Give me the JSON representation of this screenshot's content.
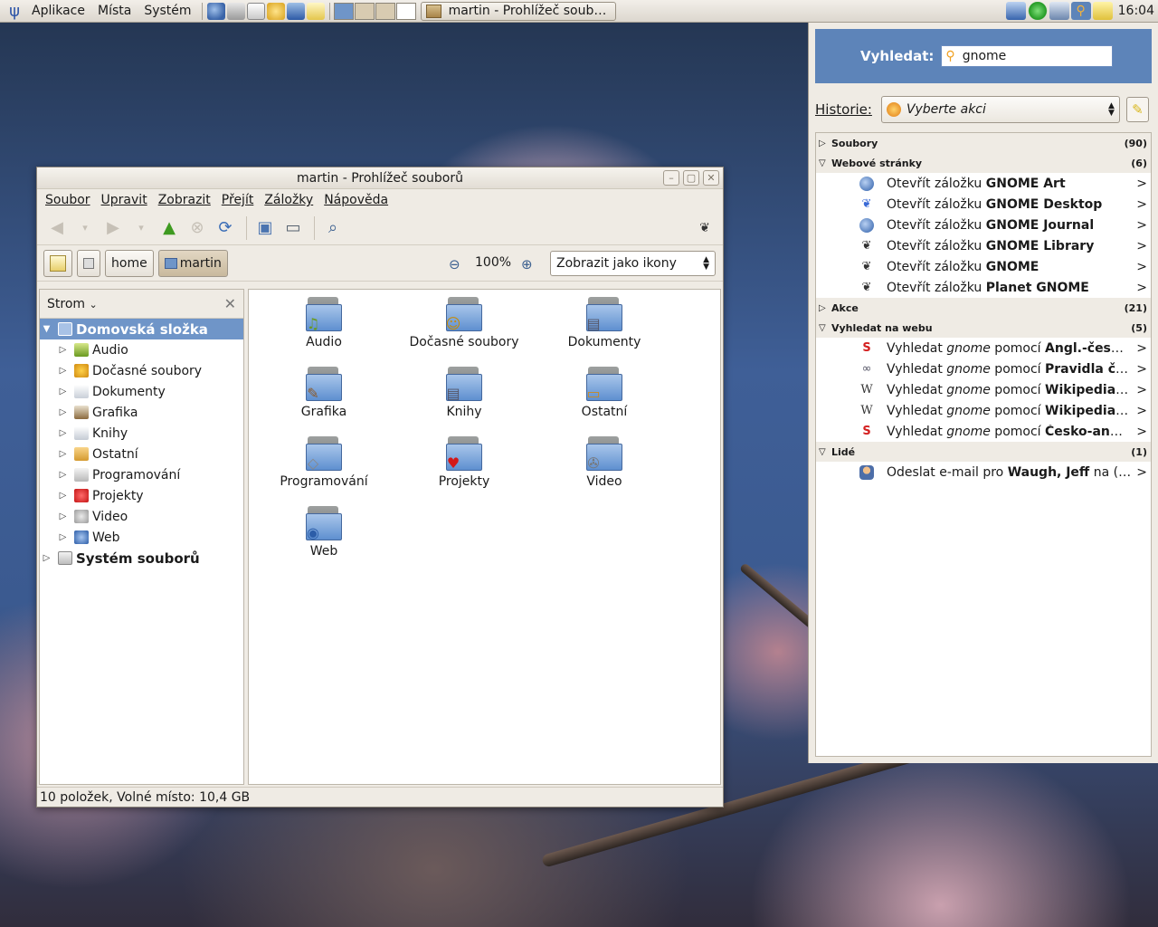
{
  "top_panel": {
    "menus": [
      "Aplikace",
      "Místa",
      "Systém"
    ],
    "task_title": "martin - Prohlížeč soub…",
    "clock": "16:04"
  },
  "file_manager": {
    "title": "martin - Prohlížeč souborů",
    "menu": [
      "Soubor",
      "Upravit",
      "Zobrazit",
      "Přejít",
      "Záložky",
      "Nápověda"
    ],
    "path": [
      "home",
      "martin"
    ],
    "zoom": "100%",
    "view_mode": "Zobrazit jako ikony",
    "side_title": "Strom",
    "tree_root": "Domovská složka",
    "tree_items": [
      "Audio",
      "Dočasné soubory",
      "Dokumenty",
      "Grafika",
      "Knihy",
      "Ostatní",
      "Programování",
      "Projekty",
      "Video",
      "Web"
    ],
    "tree_fs": "Systém souborů",
    "folders": [
      "Audio",
      "Dočasné soubory",
      "Dokumenty",
      "Grafika",
      "Knihy",
      "Ostatní",
      "Programování",
      "Projekty",
      "Video",
      "Web"
    ],
    "status": "10 položek, Volné místo: 10,4 GB"
  },
  "deskbar": {
    "search_label": "Vyhledat:",
    "search_value": "gnome",
    "history_label": "Historie:",
    "history_value": "Vyberte akci",
    "categories": [
      {
        "name": "Soubory",
        "count": "(90)",
        "expanded": false
      },
      {
        "name": "Webové stránky",
        "count": "(6)",
        "expanded": true
      },
      {
        "name": "Akce",
        "count": "(21)",
        "expanded": false
      },
      {
        "name": "Vyhledat na webu",
        "count": "(5)",
        "expanded": true
      },
      {
        "name": "Lidé",
        "count": "(1)",
        "expanded": true
      }
    ],
    "bookmark_prefix": "Otevřít záložku ",
    "bookmarks": [
      "GNOME Art",
      "GNOME Desktop",
      "GNOME Journal",
      "GNOME Library",
      "GNOME",
      "Planet GNOME"
    ],
    "web_prefix": "Vyhledat ",
    "web_query": "gnome",
    "web_mid": " pomocí ",
    "web_searches": [
      "Angl.-český …",
      "Pravidla čes…",
      "Wikipedia (a…",
      "Wikipedia (č…",
      "Česko-angl. …"
    ],
    "people_prefix": "Odeslat e-mail pro ",
    "people_name": "Waugh, Jeff",
    "people_suffix": " na (jd…",
    "more": ">"
  },
  "colors": {
    "accent": "#5d84b9",
    "selection": "#6f95c8",
    "panel": "#efebe4"
  }
}
